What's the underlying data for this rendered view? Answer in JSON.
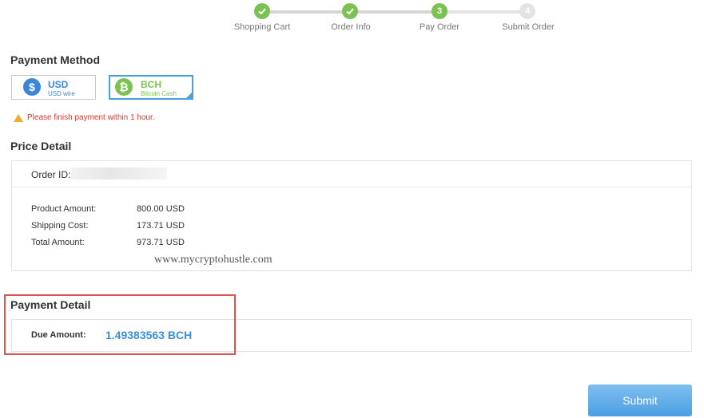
{
  "steps": [
    {
      "label": "Shopping Cart",
      "marker": "check"
    },
    {
      "label": "Order Info",
      "marker": "check"
    },
    {
      "label": "Pay Order",
      "marker": "3"
    },
    {
      "label": "Submit Order",
      "marker": "4"
    }
  ],
  "payment_method": {
    "title": "Payment Method",
    "options": [
      {
        "name": "USD",
        "sub": "USD wire",
        "icon": "dollar-icon",
        "color": "#3a87d8",
        "selected": false
      },
      {
        "name": "BCH",
        "sub": "Bitcoin Cash",
        "icon": "bitcoin-icon",
        "color": "#7cc253",
        "selected": true
      }
    ],
    "warning": "Please finish payment within 1 hour."
  },
  "price_detail": {
    "title": "Price Detail",
    "order_id_label": "Order ID:",
    "rows": [
      {
        "label": "Product Amount:",
        "value": "800.00 USD"
      },
      {
        "label": "Shipping Cost:",
        "value": "173.71 USD"
      },
      {
        "label": "Total Amount:",
        "value": "973.71 USD"
      }
    ],
    "watermark": "www.mycryptohustle.com"
  },
  "payment_detail": {
    "title": "Payment Detail",
    "due_label": "Due Amount:",
    "due_value": "1.49383563 BCH"
  },
  "submit_label": "Submit",
  "colors": {
    "accent": "#4aa0dd",
    "step_done": "#7cc253",
    "warning": "#e0362c",
    "highlight_box": "#d9534f"
  }
}
